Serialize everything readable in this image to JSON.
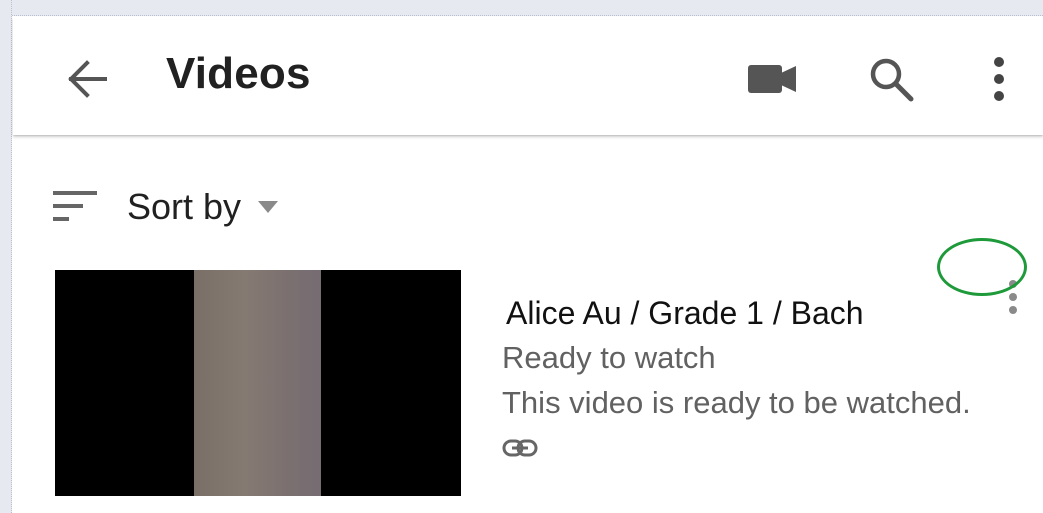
{
  "appbar": {
    "title": "Videos",
    "back_icon": "arrow-back-icon",
    "actions": [
      {
        "name": "record-video",
        "icon": "videocam-icon"
      },
      {
        "name": "search",
        "icon": "search-icon"
      },
      {
        "name": "more",
        "icon": "more-vert-icon"
      }
    ]
  },
  "sort": {
    "label": "Sort by",
    "icon": "sort-icon",
    "caret_icon": "dropdown-caret-icon"
  },
  "videos": [
    {
      "title": "Alice Au / Grade 1 / Bach",
      "status": "Ready to watch",
      "description": "This video is ready to be watched.",
      "link_icon": "link-icon",
      "menu_icon": "more-vert-icon"
    }
  ],
  "colors": {
    "title_text": "#212121",
    "secondary_text": "#616161",
    "icon": "#555555",
    "highlight": "#1e9a3a"
  }
}
